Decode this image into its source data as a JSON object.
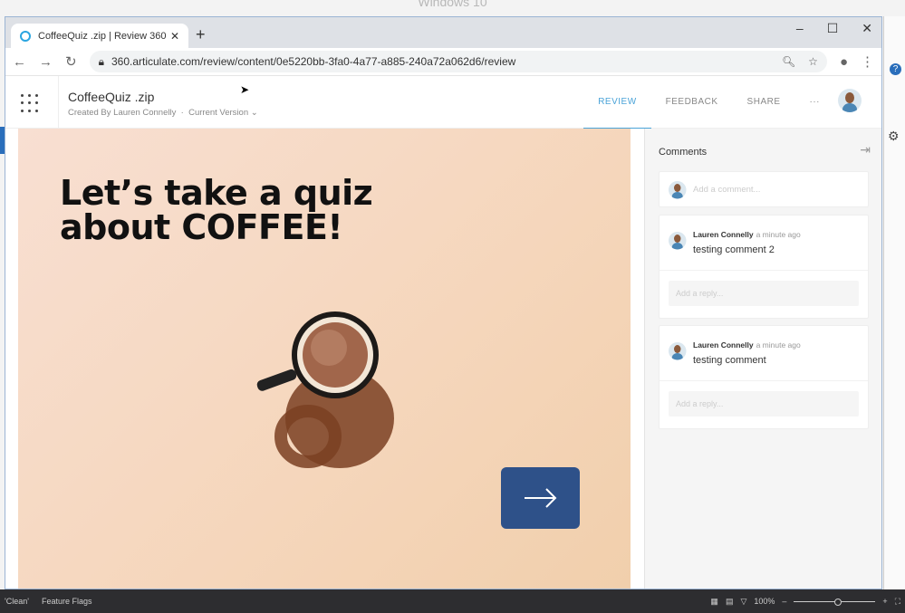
{
  "os": {
    "title": "Windows 10"
  },
  "browser": {
    "tab_title": "CoffeeQuiz .zip | Review 360",
    "url": "360.articulate.com/review/content/0e5220bb-3fa0-4a77-a885-240a72a062d6/review"
  },
  "app": {
    "title": "CoffeeQuiz .zip",
    "created_by": "Created By Lauren Connelly",
    "version": "Current Version",
    "nav": [
      "REVIEW",
      "FEEDBACK",
      "SHARE"
    ],
    "more": "···"
  },
  "slide": {
    "line1": "Let’s take a quiz",
    "line2": "about COFFEE!",
    "accent": "#2e5189"
  },
  "comments": {
    "title": "Comments",
    "add_placeholder": "Add a comment...",
    "items": [
      {
        "author": "Lauren Connelly",
        "time": "a minute ago",
        "text": "testing comment 2",
        "reply_placeholder": "Add a reply..."
      },
      {
        "author": "Lauren Connelly",
        "time": "a minute ago",
        "text": "testing comment",
        "reply_placeholder": "Add a reply..."
      }
    ]
  },
  "status": {
    "left1": "'Clean'",
    "left2": "Feature Flags",
    "zoom": "100%"
  }
}
